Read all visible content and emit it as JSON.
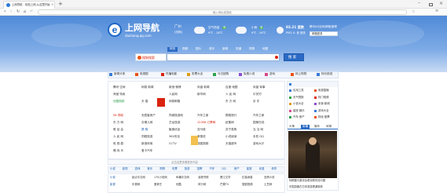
{
  "browser": {
    "tab_title": "上网导航 - 轻松上网,从这里开始",
    "new_tab": "+",
    "address_placeholder": "输入网址或搜索"
  },
  "header": {
    "logo_text": "上网导航",
    "logo_sub": "daohang.qq.com",
    "city": "广州",
    "city_link": "[切换]",
    "weather1": {
      "label": "空气质量",
      "badge": "良",
      "temp": "9℃ - 18℃"
    },
    "weather2": {
      "label": "小雨",
      "badge": "良",
      "temp": "9℃ - 16℃"
    },
    "aqi": {
      "value": "83.21 度数",
      "sub": "PM2.5: 良"
    },
    "user": {
      "line1": "腾讯QQ空间/邮箱/微博",
      "line2": "登录",
      "login_btn": "邮箱登录"
    }
  },
  "search": {
    "tabs": [
      "网页",
      "视频",
      "图片",
      "音乐",
      "新闻",
      "知道",
      "购物",
      "地图"
    ],
    "active_tab": 0,
    "engine_label": "搜狗搜索",
    "button": "搜 索",
    "hot": "热门搜索"
  },
  "category_bar": [
    {
      "icon": "newspaper-icon",
      "label": "新闻头条"
    },
    {
      "icon": "tv-icon",
      "label": "电视剧"
    },
    {
      "icon": "film-icon",
      "label": "热播电影"
    },
    {
      "icon": "lottery-icon",
      "label": "彩票大全"
    },
    {
      "icon": "buy-icon",
      "label": "今日团购"
    },
    {
      "icon": "game-icon",
      "label": "免费小说"
    },
    {
      "icon": "game2-icon",
      "label": "游戏"
    },
    {
      "icon": "cart-icon",
      "label": "网上购物"
    },
    {
      "icon": "grid-icon",
      "label": "特价航班"
    }
  ],
  "sites": [
    [
      "腾讯·空间",
      "网易·新闻",
      "新浪·微博",
      "凤凰·新闻",
      "百度·地图",
      "凤凰·军事"
    ],
    [
      "淘宝·特卖",
      "",
      "人民网",
      "新华网",
      "人 民 网",
      "中关村"
    ],
    [
      "优酷视频",
      "天 猫",
      "网易邮箱",
      "",
      "东 方 网",
      "京 东"
    ],
    [
      "",
      "",
      "",
      "",
      "",
      ""
    ],
    [
      "58 同城",
      "安居客房产",
      "同城旅游网",
      "汽车之家",
      "携程旅行",
      "汽车之家"
    ],
    [
      "东 方 网",
      "去哪儿网",
      "艺龙旅游",
      "12306 订票网",
      "赶集网",
      "国美在线"
    ],
    [
      "唯 品 会",
      "携 程",
      "聚美优品",
      "亚马逊",
      "苏宁易购",
      "当 当 网"
    ],
    [
      "人 民 网",
      "同程旅游",
      "360安全",
      "美丽说",
      "小说阅读",
      "手机 QQ"
    ],
    [
      "电 视 剧",
      "新浪体育",
      "CCTV",
      "搜狐视频",
      "天猫超市",
      "游戏大厅"
    ],
    [
      "唱 戏 乐",
      "爱卡汽车",
      "",
      "",
      "",
      ""
    ]
  ],
  "side": {
    "links": [
      "实用工具",
      "电视直播",
      "天气预报",
      "热门视频",
      "小说大全",
      "军事·新闻",
      "星座·娱乐",
      "游戏大全",
      "汽车·房产",
      "财经·股票"
    ],
    "tabs": [
      "头条",
      "军事",
      "娱乐",
      "体育"
    ],
    "news": [
      "特朗普与普京会晤谈叙利亚问题",
      "中国游客在日本旅游遭遇事故"
    ]
  },
  "bottom_notice": "点击这里查看更多内容",
  "bottom_tabs": [
    "小说",
    "影视",
    "游戏",
    "音乐",
    "购物",
    "彩票",
    "旅游",
    "招聘",
    "汽车",
    "QQ",
    "房产",
    "星座",
    "动漫",
    "体育"
  ],
  "bottom_rows": [
    [
      "小说",
      "起点中文网",
      "17K小说网",
      "纵横中文网",
      "潇湘书院",
      "晋江文学",
      "红袖添香",
      "言情小说"
    ],
    [
      "影视",
      "乐视网",
      "爱奇艺",
      "优酷",
      "风行网",
      "芒果TV",
      "搜狐视频",
      "土豆网"
    ]
  ]
}
